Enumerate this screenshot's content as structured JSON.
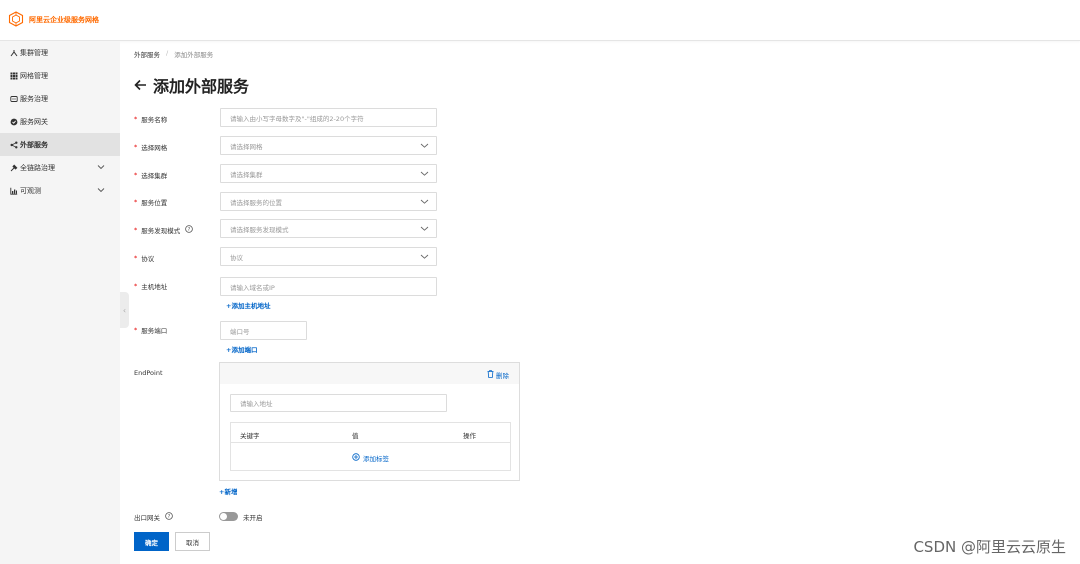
{
  "app": {
    "title": "阿里云企业级服务网格",
    "brand_color": "#ff6a00"
  },
  "sidebar": {
    "items": [
      {
        "label": "集群管理",
        "icon": "cluster-icon"
      },
      {
        "label": "网格管理",
        "icon": "grid-icon"
      },
      {
        "label": "服务治理",
        "icon": "governance-icon"
      },
      {
        "label": "服务网关",
        "icon": "gateway-icon"
      },
      {
        "label": "外部服务",
        "icon": "share-icon",
        "active": true
      },
      {
        "label": "全链路治理",
        "icon": "tool-icon",
        "expandable": true
      },
      {
        "label": "可观测",
        "icon": "chart-icon",
        "expandable": true
      }
    ]
  },
  "breadcrumb": {
    "parent": "外部服务",
    "separator": "/",
    "current": "添加外部服务"
  },
  "page": {
    "title": "添加外部服务",
    "back_icon": "arrow-left-icon"
  },
  "form": {
    "service_name": {
      "label": "服务名称",
      "placeholder": "请输入由小写字母数字及\"-\"组成的2-20个字符"
    },
    "mesh": {
      "label": "选择网格",
      "placeholder": "请选择网格"
    },
    "cluster": {
      "label": "选择集群",
      "placeholder": "请选择集群"
    },
    "location": {
      "label": "服务位置",
      "placeholder": "请选择服务的位置"
    },
    "discovery": {
      "label": "服务发现模式",
      "placeholder": "请选择服务发现模式"
    },
    "protocol": {
      "label": "协议",
      "placeholder": "协议"
    },
    "host": {
      "label": "主机地址",
      "placeholder": "请输入域名或IP",
      "add_link": "+添加主机地址"
    },
    "port": {
      "label": "服务端口",
      "placeholder": "端口号",
      "add_link": "+添加端口"
    },
    "endpoint": {
      "label": "EndPoint",
      "delete": "删除",
      "address_placeholder": "请输入地址",
      "columns": [
        "关键字",
        "值",
        "操作"
      ],
      "add_tag": "添加标签",
      "add_new": "+新增"
    },
    "egress": {
      "label": "出口网关",
      "status": "未开启",
      "enabled": false
    }
  },
  "actions": {
    "confirm": "确定",
    "cancel": "取消"
  },
  "colors": {
    "primary": "#0064c8",
    "required": "#e60000"
  },
  "watermark": "CSDN @阿里云云原生"
}
